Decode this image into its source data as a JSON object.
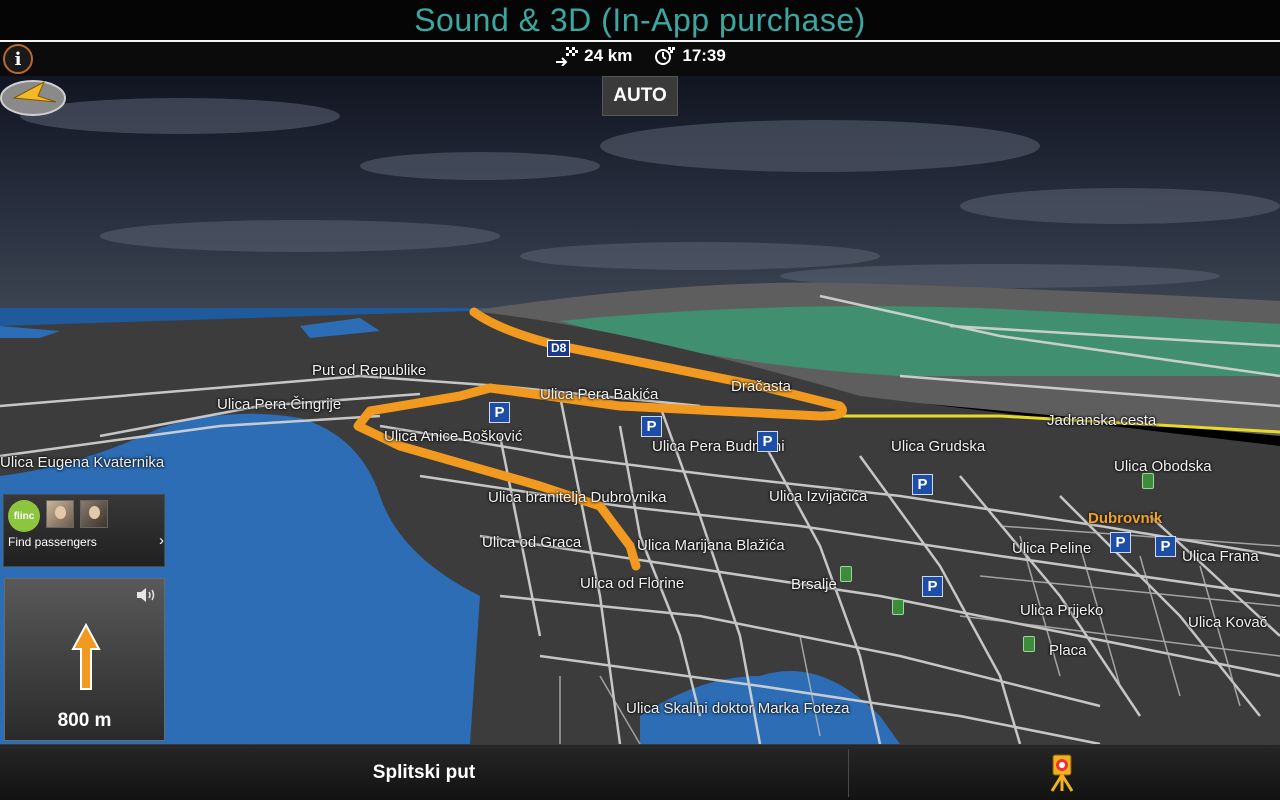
{
  "promo": {
    "title": "Sound & 3D (In-App purchase)"
  },
  "status": {
    "distance": "24 km",
    "arrival_time": "17:39"
  },
  "map": {
    "mode_button": "AUTO",
    "road_shield": "D8",
    "streets": [
      "Put od Republike",
      "Ulica Pera Čingrije",
      "Ulica Eugena Kvaternika",
      "Ulica Anice Bošković",
      "Ulica Pera Bakića",
      "Dračasta",
      "Ulica Pera Budmani",
      "Jadranska cesta",
      "Ulica Grudska",
      "Ulica Obodska",
      "Ulica branitelja Dubrovnika",
      "Ulica Izvijačića",
      "Ulica od Graca",
      "Ulica Marijana Blažića",
      "Ulica od Florine",
      "Brsalje",
      "Ulica Peline",
      "Ulica Frana",
      "Ulica Prijeko",
      "Ulica Kovač",
      "Placa",
      "Ulica Skalini doktor Marka Foteza"
    ],
    "city": "Dubrovnik",
    "parking_symbol": "P",
    "colors": {
      "water": "#2b6bb4",
      "land": "#3a3a3a",
      "route": "#f29a1f",
      "roads": "#d9d9d9",
      "sky": "#1d2230"
    }
  },
  "passengers": {
    "logo_text": "flinc",
    "label": "Find passengers"
  },
  "maneuver": {
    "distance": "800 m",
    "direction": "straight",
    "icon": "arrow-up-icon"
  },
  "bottom": {
    "current_street": "Splitski put",
    "camera_icon": "speed-camera-icon"
  }
}
